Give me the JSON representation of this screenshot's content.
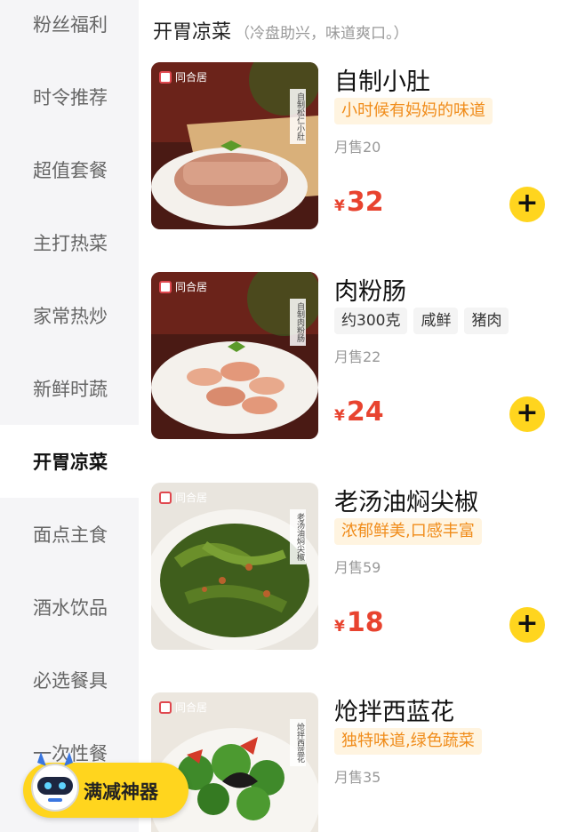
{
  "sidebar": {
    "items": [
      {
        "label": "粉丝福利"
      },
      {
        "label": "时令推荐"
      },
      {
        "label": "超值套餐"
      },
      {
        "label": "主打热菜"
      },
      {
        "label": "家常热炒"
      },
      {
        "label": "新鲜时蔬"
      },
      {
        "label": "开胃凉菜",
        "active": true
      },
      {
        "label": "面点主食"
      },
      {
        "label": "酒水饮品"
      },
      {
        "label": "必选餐具"
      },
      {
        "label": "一次性餐"
      }
    ]
  },
  "section": {
    "title": "开胃凉菜",
    "subtitle": "（冷盘助兴，味道爽口。）"
  },
  "items": [
    {
      "name": "自制小肚",
      "promo": "小时候有妈妈的味道",
      "sales": "月售20",
      "currency": "¥",
      "price": "32",
      "brand": "同合居",
      "image_label": "自制松仁小肚",
      "icon": "sliced-sausage-plate"
    },
    {
      "name": "肉粉肠",
      "tags": [
        "约300克",
        "咸鲜",
        "猪肉"
      ],
      "sales": "月售22",
      "currency": "¥",
      "price": "24",
      "brand": "同合居",
      "image_label": "自制肉粉肠",
      "icon": "sausage-slices-plate"
    },
    {
      "name": "老汤油焖尖椒",
      "promo": "浓郁鲜美,口感丰富",
      "sales": "月售59",
      "currency": "¥",
      "price": "18",
      "brand": "同合居",
      "image_label": "老汤油焖尖椒",
      "icon": "braised-peppers-plate"
    },
    {
      "name": "炝拌西蓝花",
      "promo": "独特味道,绿色蔬菜",
      "sales": "月售35",
      "currency": "¥",
      "brand": "同合居",
      "image_label": "炝拌西蓝花",
      "icon": "broccoli-plate"
    }
  ],
  "add_button": "+",
  "promo_badge": {
    "label": "满减神器",
    "icon": "robot-mascot-icon"
  },
  "colors": {
    "accent_yellow": "#ffd51e",
    "price_red": "#e8432f",
    "promo_orange": "#f08c1a",
    "promo_bg": "#fff4e0",
    "sidebar_bg": "#f5f5f7"
  }
}
